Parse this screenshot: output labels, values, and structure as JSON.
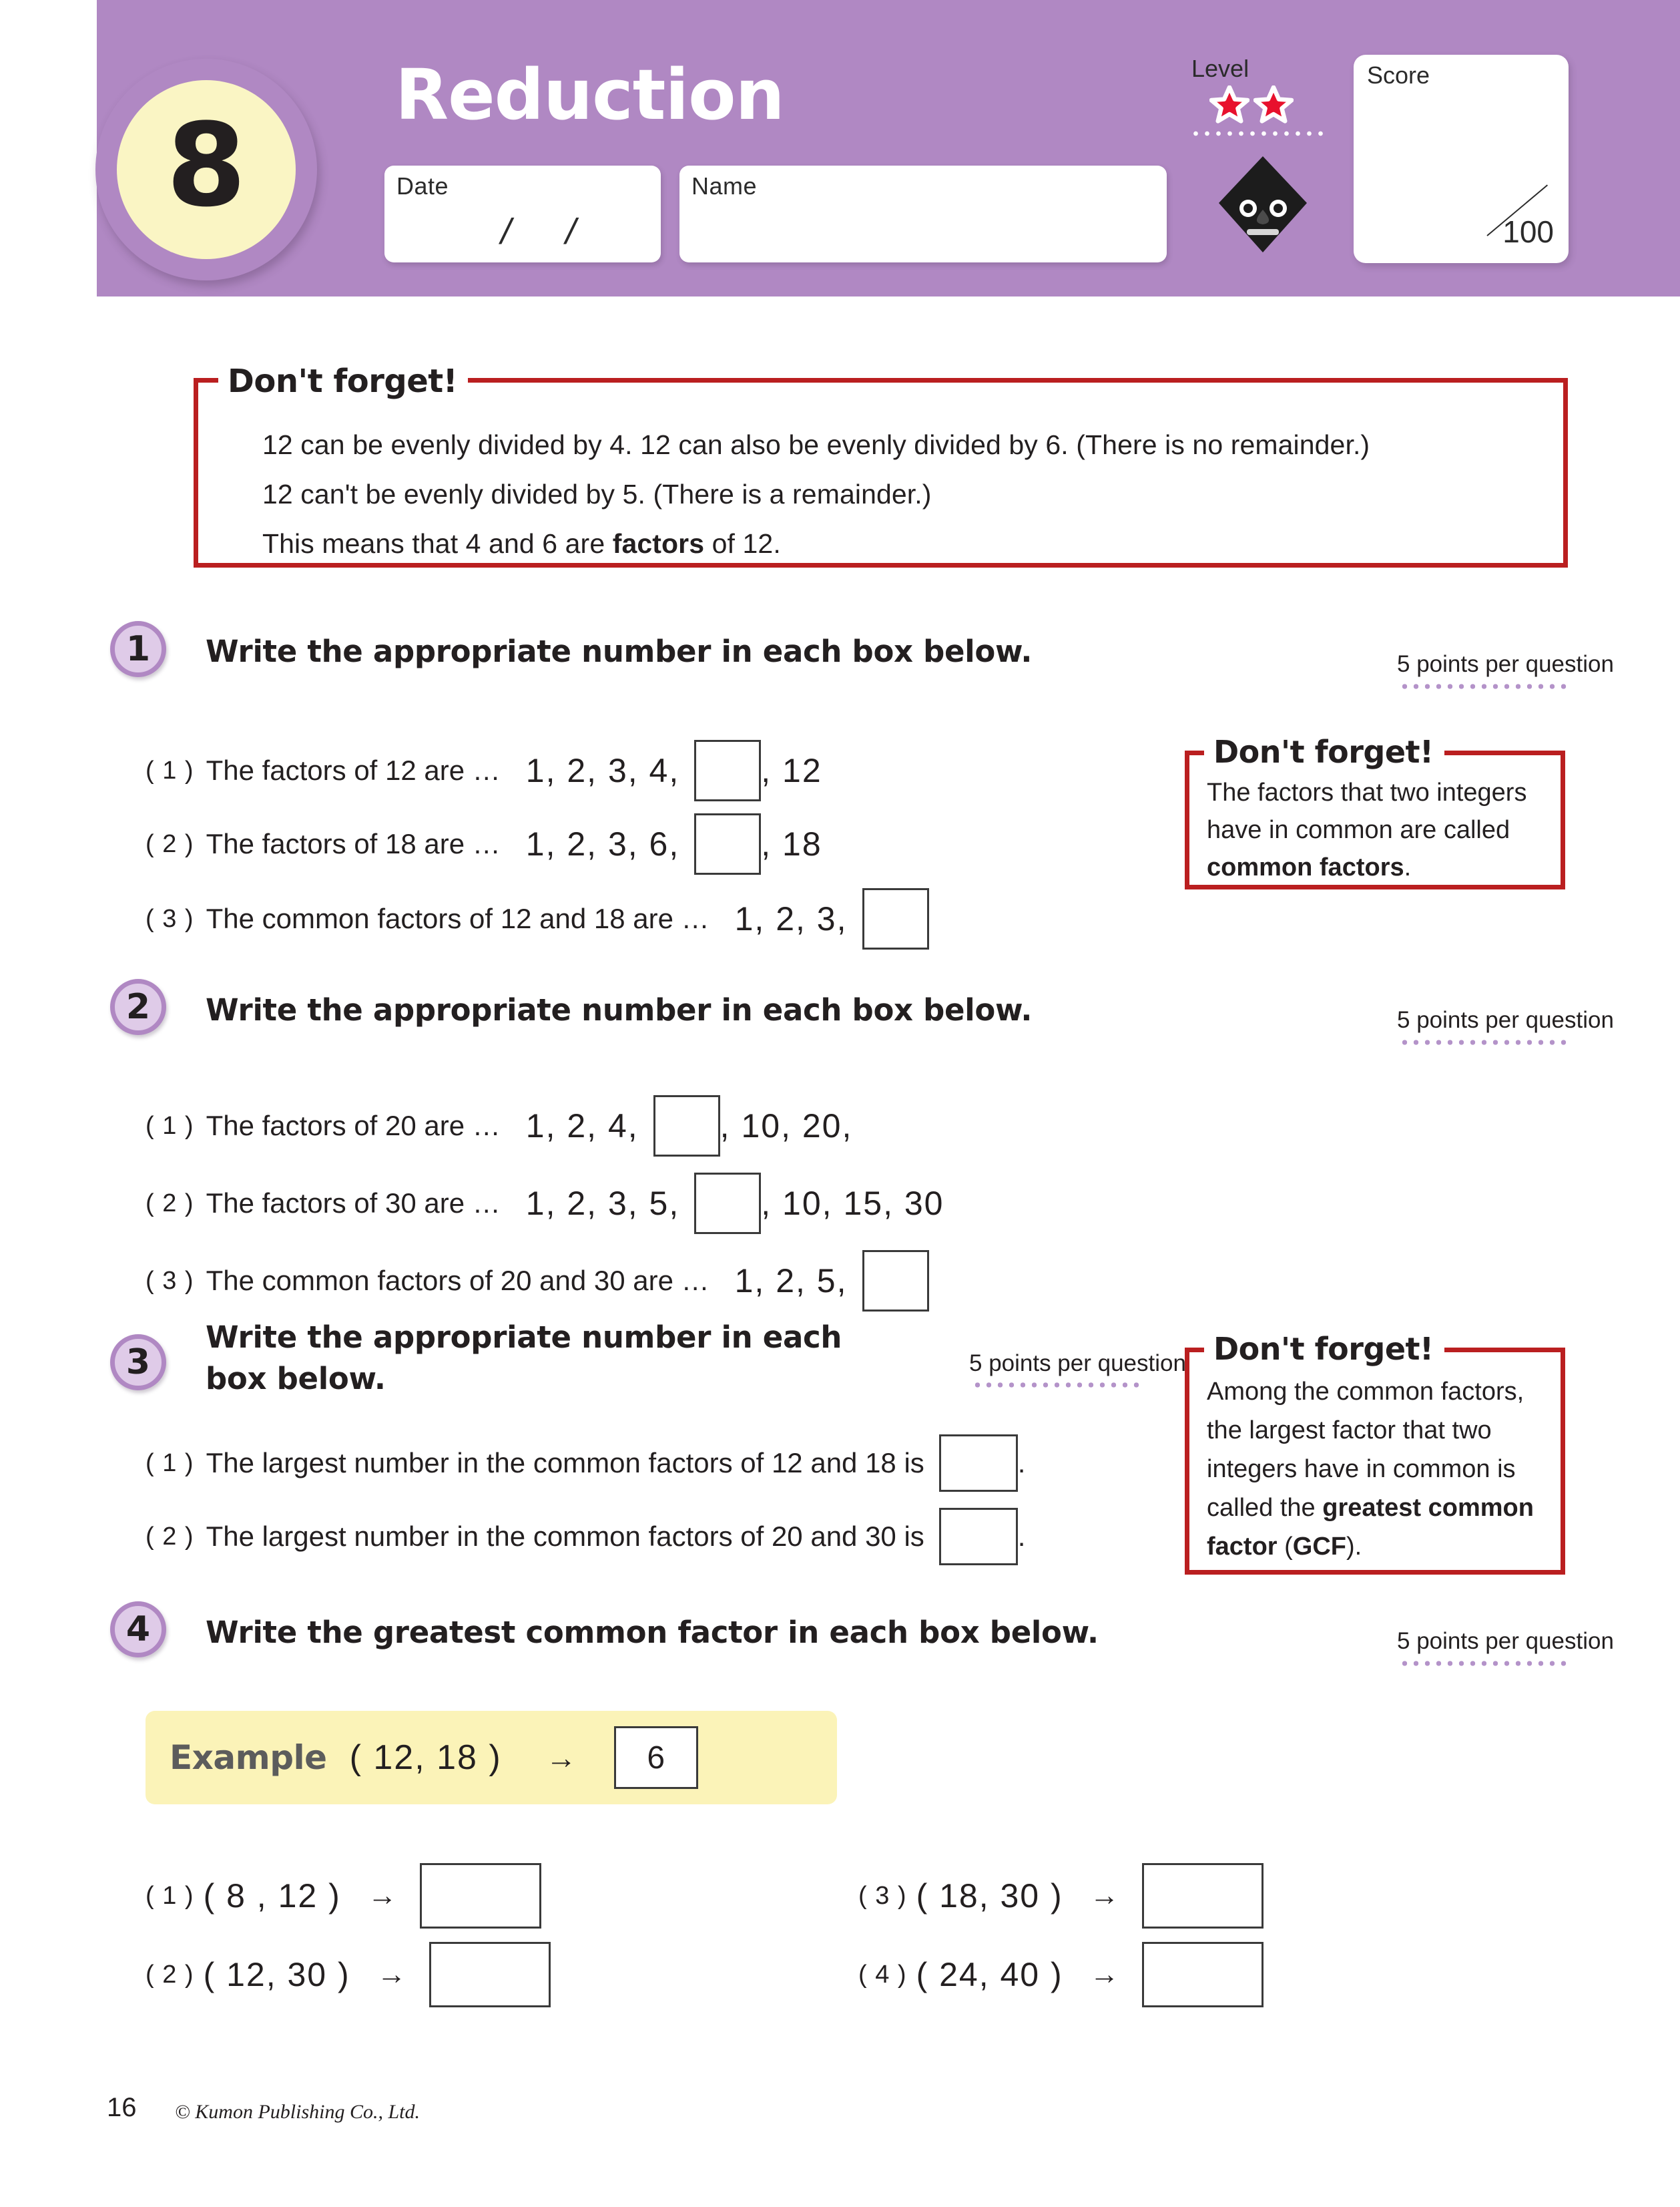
{
  "header": {
    "unit_number": "8",
    "title": "Reduction",
    "date_label": "Date",
    "date_slash_1": "/",
    "date_slash_2": "/",
    "name_label": "Name",
    "level_label": "Level",
    "level_stars": 2,
    "score_label": "Score",
    "score_total": "100",
    "accent_purple": "#b088c3",
    "circle_yellow": "#faf5c4",
    "star_red": "#e8112d"
  },
  "df_main": {
    "title": "Don't forget!",
    "line1": "12 can be evenly divided by 4. 12 can also be evenly divided by 6. (There is no remainder.)",
    "line2": "12 can't be evenly divided by 5. (There is a remainder.)",
    "line3_pre": "This means that 4 and 6 are ",
    "line3_bold": "factors",
    "line3_post": " of 12.",
    "border_red": "#ba1f20"
  },
  "df_side1": {
    "title": "Don't forget!",
    "text_pre": "The factors that two integers have in common are called ",
    "text_bold": "common factors",
    "text_post": "."
  },
  "df_side2": {
    "title": "Don't forget!",
    "text_pre": "Among the common factors, the largest factor that two integers have in common is called the ",
    "text_bold1": "greatest common factor",
    "text_mid": " (",
    "text_bold2": "GCF",
    "text_post": ")."
  },
  "points_note": "5 points per question",
  "q1": {
    "number": "1",
    "heading": "Write the appropriate number in each box below.",
    "items": [
      {
        "label": "( 1 )",
        "text": "The factors of 12 are …",
        "before": "1,   2,   3,   4,",
        "after": ",   12"
      },
      {
        "label": "( 2 )",
        "text": "The factors of 18 are …",
        "before": "1,   2,   3,   6,",
        "after": ",   18"
      },
      {
        "label": "( 3 )",
        "text": "The common factors of 12 and 18 are …",
        "before": "1,   2,   3,",
        "after": ""
      }
    ]
  },
  "q2": {
    "number": "2",
    "heading": "Write the appropriate number in each box below.",
    "items": [
      {
        "label": "( 1 )",
        "text": "The factors of 20 are …",
        "before": "1,   2,   4,",
        "after": ",   10,   20,"
      },
      {
        "label": "( 2 )",
        "text": "The factors of 30 are …",
        "before": "1,   2,   3,   5,",
        "after": ",   10,   15,   30"
      },
      {
        "label": "( 3 )",
        "text": "The common factors of 20 and 30 are …",
        "before": "1,   2,   5,",
        "after": ""
      }
    ]
  },
  "q3": {
    "number": "3",
    "heading_line1": "Write the appropriate number in each",
    "heading_line2": "box below.",
    "items": [
      {
        "label": "( 1 )",
        "text": "The largest number in the common factors of 12 and 18 is",
        "after": "."
      },
      {
        "label": "( 2 )",
        "text": "The largest number in the common factors of 20 and 30 is",
        "after": "."
      }
    ]
  },
  "q4": {
    "number": "4",
    "heading": "Write the greatest common factor in each box below.",
    "example": {
      "label": "Example",
      "pair": "( 12,  18 )",
      "arrow": "→",
      "answer": "6"
    },
    "items": [
      {
        "label": "( 1 )",
        "pair": "( 8 ,  12 )",
        "arrow": "→"
      },
      {
        "label": "( 2 )",
        "pair": "( 12,  30 )",
        "arrow": "→"
      },
      {
        "label": "( 3 )",
        "pair": "( 18,  30 )",
        "arrow": "→"
      },
      {
        "label": "( 4 )",
        "pair": "( 24,  40 )",
        "arrow": "→"
      }
    ]
  },
  "footer": {
    "page_number": "16",
    "copyright": "© Kumon Publishing Co., Ltd."
  }
}
